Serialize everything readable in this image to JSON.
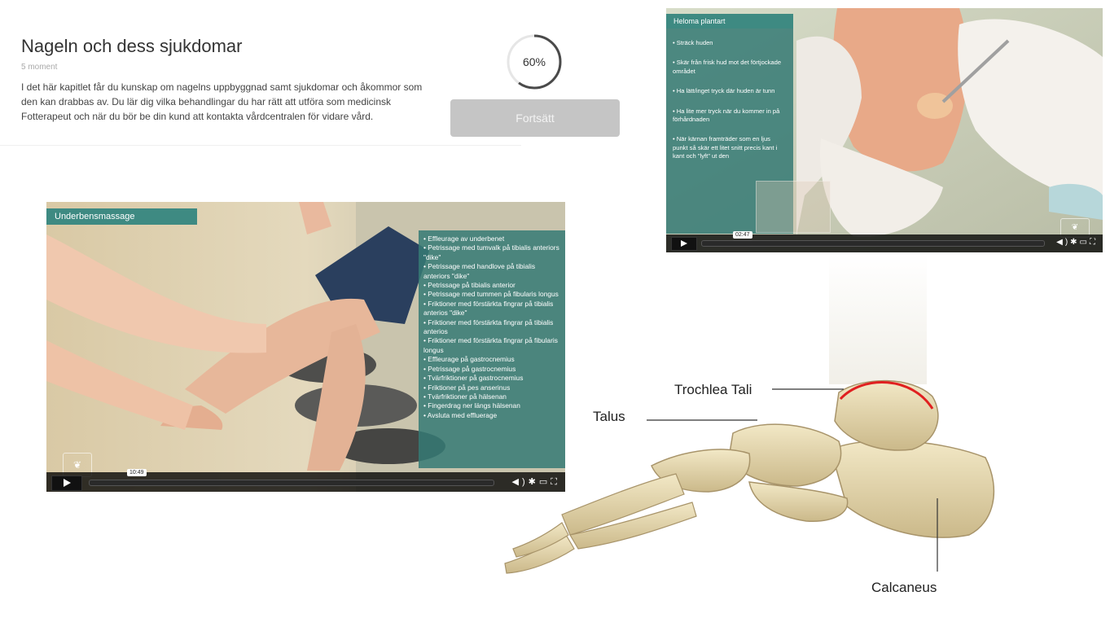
{
  "course": {
    "title": "Nageln och dess sjukdomar",
    "moment_count": "5 moment",
    "description": "I det här kapitlet får du kunskap om nagelns uppbyggnad samt sjukdomar och åkommor som den kan drabbas av. Du lär dig vilka behandlingar du har rätt att utföra som medicinsk Fotterapeut och när du bör be din kund att kontakta vårdcentralen för vidare vård.",
    "progress_label": "60%",
    "progress_fraction": 0.6,
    "continue_label": "Fortsätt"
  },
  "video1": {
    "title": "Underbensmassage",
    "time": "10:49",
    "steps": [
      "• Effleurage av underbenet",
      "• Petrissage med tumvalk på tibialis anteriors \"dike\"",
      "• Petrissage med handlove på tibialis anteriors \"dike\"",
      "• Petrissage på tibialis anterior",
      "• Petrissage med tummen på fibularis longus",
      "• Friktioner med förstärkta fingrar på tibialis anterios \"dike\"",
      "• Friktioner med förstärkta fingrar på tibialis anterios",
      "• Friktioner med förstärkta fingrar på fibularis longus",
      "• Effleurage på gastrocnemius",
      "• Petrissage på gastrocnemius",
      "• Tvärfriktioner på gastrocnemius",
      "• Friktioner på pes anserinus",
      "• Tvärfriktioner på hälsenan",
      "• Fingerdrag ner längs hälsenan",
      "• Avsluta med effluerage"
    ],
    "controls": {
      "volume_icon": "volume-icon",
      "settings_icon": "gear-icon",
      "pip_icon": "pip-icon",
      "fullscreen_icon": "fullscreen-icon"
    }
  },
  "video2": {
    "title": "Heloma plantart",
    "time": "02:47",
    "steps": [
      "• Sträck huden",
      "• Skär från frisk hud mot det förtjockade området",
      "• Ha lätt/inget tryck där huden är tunn",
      "• Ha lite mer tryck när du kommer in på förhårdnaden",
      "• När kärnan framträder som en ljus punkt så skär ett litet snitt precis kant i kant och \"lyft\" ut den"
    ]
  },
  "anatomy": {
    "labels": {
      "trochlea": "Trochlea Tali",
      "talus": "Talus",
      "calcaneus": "Calcaneus"
    },
    "highlight_color": "#e02020"
  },
  "colors": {
    "accent_teal": "#3e8a82",
    "button_gray": "#c5c5c5"
  }
}
